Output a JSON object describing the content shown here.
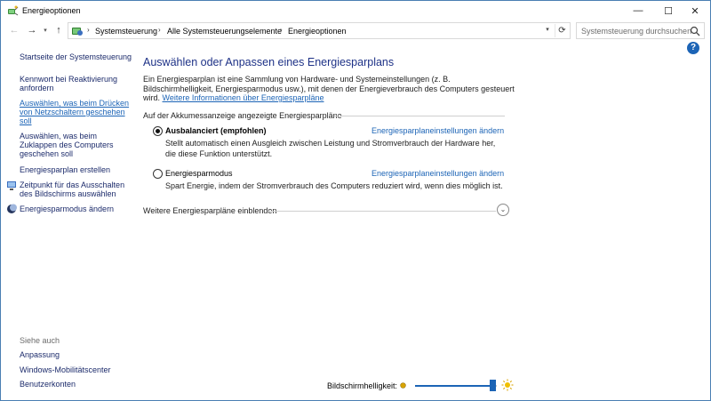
{
  "window": {
    "title": "Energieoptionen",
    "controls": {
      "minimize": "—",
      "maximize": "☐",
      "close": "✕"
    }
  },
  "address": {
    "crumbs": [
      "Systemsteuerung",
      "Alle Systemsteuerungselemente",
      "Energieoptionen"
    ],
    "search_placeholder": "Systemsteuerung durchsuchen"
  },
  "help": {
    "label": "?"
  },
  "sidebar": {
    "home": "Startseite der Systemsteuerung",
    "links": [
      {
        "lines": [
          "Kennwort bei Reaktivierung",
          "anfordern"
        ]
      },
      {
        "lines": [
          "Auswählen, was beim Drücken",
          "von Netzschaltern geschehen",
          "soll"
        ]
      },
      {
        "lines": [
          "Auswählen, was beim",
          "Zuklappen des Computers",
          "geschehen soll"
        ]
      },
      {
        "lines": [
          "Energiesparplan erstellen"
        ]
      },
      {
        "lines": [
          "Zeitpunkt für das Ausschalten",
          "des Bildschirms auswählen"
        ]
      },
      {
        "lines": [
          "Energiesparmodus ändern"
        ]
      }
    ],
    "see_also": "Siehe auch",
    "see_also_links": [
      "Anpassung",
      "Windows-Mobilitätscenter",
      "Benutzerkonten"
    ]
  },
  "main": {
    "title": "Auswählen oder Anpassen eines Energiesparplans",
    "description": "Ein Energiesparplan ist eine Sammlung von Hardware- und Systemeinstellungen (z. B. Bildschirmhelligkeit, Energiesparmodus usw.), mit denen der Energieverbrauch des Computers gesteuert wird.",
    "description_link": "Weitere Informationen über Energiesparpläne",
    "section_label": "Auf der Akkumessanzeige angezeigte Energiesparpläne",
    "plans": [
      {
        "name": "Ausbalanciert (empfohlen)",
        "selected": true,
        "link": "Energiesparplaneinstellungen ändern",
        "description": "Stellt automatisch einen Ausgleich zwischen Leistung und Stromverbrauch der Hardware her, die diese Funktion unterstützt."
      },
      {
        "name": "Energiesparmodus",
        "selected": false,
        "link": "Energiesparplaneinstellungen ändern",
        "description": "Spart Energie, indem der Stromverbrauch des Computers reduziert wird, wenn dies möglich ist."
      }
    ],
    "more_plans": "Weitere Energiesparpläne einblenden"
  },
  "brightness": {
    "label": "Bildschirmhelligkeit:",
    "level": 0.95
  }
}
